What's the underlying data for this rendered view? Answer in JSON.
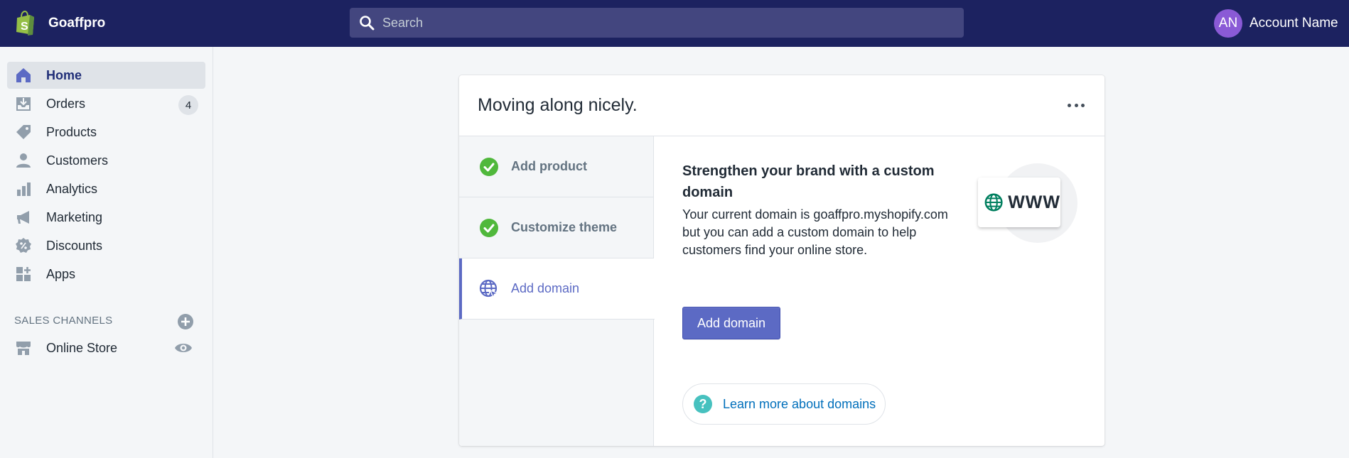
{
  "topbar": {
    "store_name": "Goaffpro",
    "search_placeholder": "Search",
    "account_initials": "AN",
    "account_name": "Account Name"
  },
  "sidebar": {
    "items": [
      {
        "label": "Home",
        "icon": "home-icon",
        "active": true
      },
      {
        "label": "Orders",
        "icon": "orders-icon",
        "badge": "4"
      },
      {
        "label": "Products",
        "icon": "tag-icon"
      },
      {
        "label": "Customers",
        "icon": "person-icon"
      },
      {
        "label": "Analytics",
        "icon": "bar-chart-icon"
      },
      {
        "label": "Marketing",
        "icon": "megaphone-icon"
      },
      {
        "label": "Discounts",
        "icon": "discount-icon"
      },
      {
        "label": "Apps",
        "icon": "apps-icon"
      }
    ],
    "sales_channels_title": "SALES CHANNELS",
    "channels": [
      {
        "label": "Online Store",
        "icon": "store-icon"
      }
    ]
  },
  "card": {
    "title": "Moving along nicely.",
    "steps": [
      {
        "label": "Add product",
        "done": true
      },
      {
        "label": "Customize theme",
        "done": true
      },
      {
        "label": "Add domain",
        "active": true
      }
    ],
    "detail": {
      "title": "Strengthen your brand with a custom domain",
      "body": "Your current domain is goaffpro.myshopify.com but you can add a custom domain to help customers find your online store.",
      "button_label": "Add domain",
      "illustration_text": "WWW",
      "learn_more": "Learn more about domains"
    }
  },
  "colors": {
    "topbar": "#1c2260",
    "accent": "#5c6ac4",
    "success": "#50b83c",
    "link": "#006fbb"
  }
}
